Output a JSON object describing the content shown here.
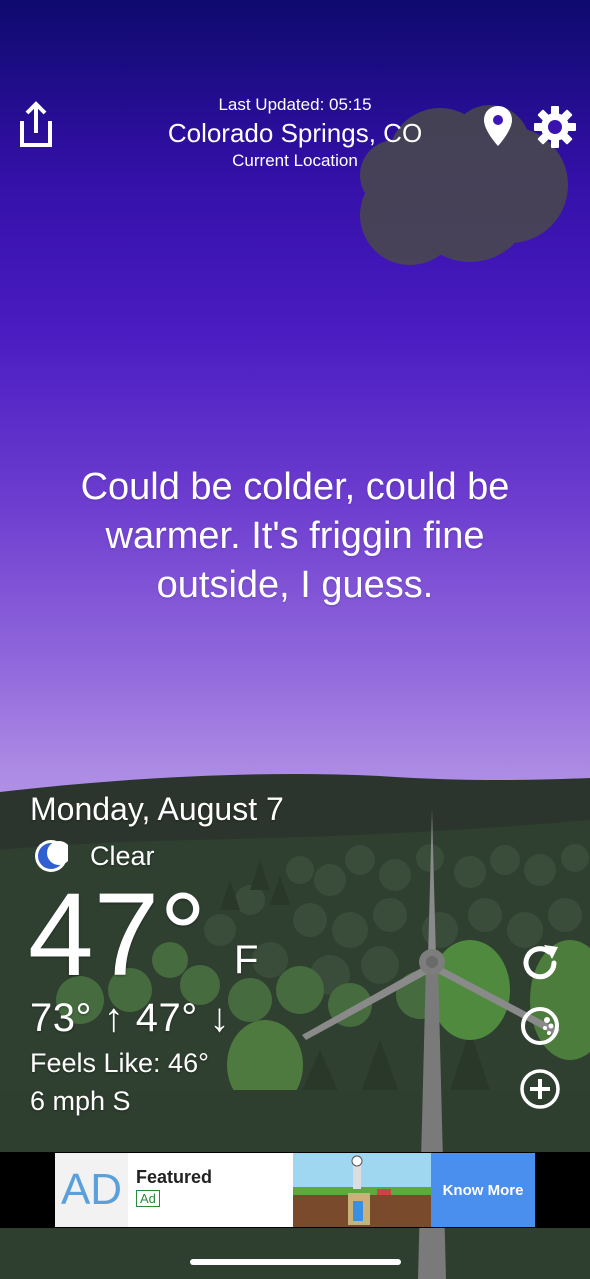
{
  "header": {
    "last_updated": "Last Updated: 05:15",
    "city": "Colorado Springs, CO",
    "subtitle": "Current Location"
  },
  "icons": {
    "share": "share-icon",
    "location": "location-pin-icon",
    "settings": "gear-icon",
    "condition": "crescent-moon-icon",
    "refresh": "refresh-icon",
    "radar": "radar-icon",
    "add": "add-icon"
  },
  "headline": "Could be colder, could be warmer. It's friggin fine outside, I guess.",
  "current": {
    "date": "Monday, August 7",
    "condition": "Clear",
    "temperature": "47°",
    "unit": "F",
    "hi_lo": "73° ↑ 47° ↓",
    "feels_like": "Feels Like: 46°",
    "wind": "6 mph S"
  },
  "ad": {
    "logo": "AD",
    "title": "Featured",
    "tag": "Ad",
    "cta": "Know More"
  },
  "colors": {
    "sky_top": "#0e0a6e",
    "sky_mid": "#4a1cc2",
    "sky_low": "#b496e8",
    "hills": "#2b3a2c",
    "ad_cta": "#4a8fee"
  }
}
